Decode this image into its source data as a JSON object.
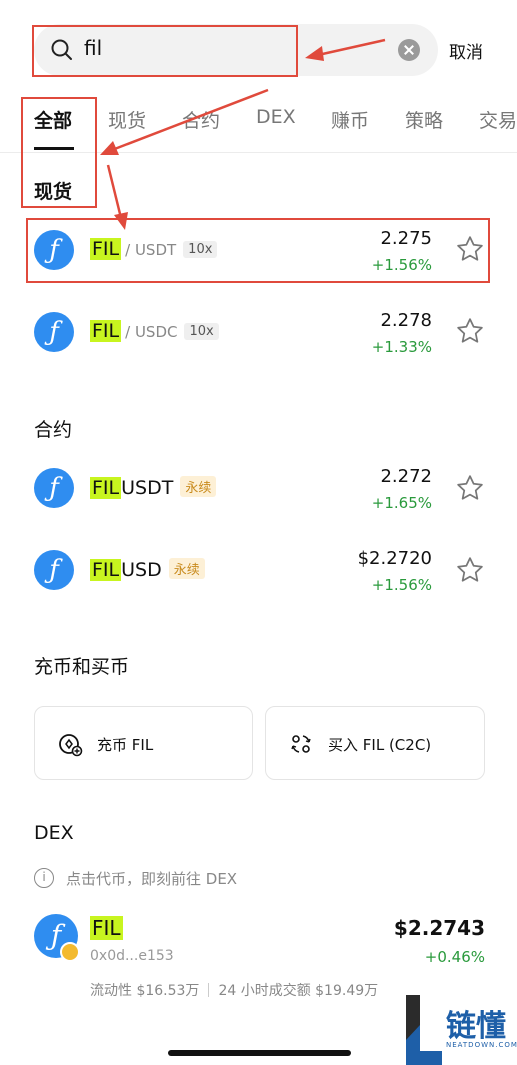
{
  "search": {
    "query": "fil",
    "cancel_label": "取消"
  },
  "tabs": [
    "全部",
    "现货",
    "合约",
    "DEX",
    "赚币",
    "策略",
    "交易"
  ],
  "spot": {
    "title": "现货",
    "rows": [
      {
        "base": "FIL",
        "quote": "/ USDT",
        "badge": "10x",
        "price": "2.275",
        "change": "+1.56%"
      },
      {
        "base": "FIL",
        "quote": "/ USDC",
        "badge": "10x",
        "price": "2.278",
        "change": "+1.33%"
      }
    ]
  },
  "futures": {
    "title": "合约",
    "rows": [
      {
        "base": "FIL",
        "rest": "USDT",
        "badge": "永续",
        "price": "2.272",
        "change": "+1.65%"
      },
      {
        "base": "FIL",
        "rest": "USD",
        "badge": "永续",
        "price": "$2.2720",
        "change": "+1.56%"
      }
    ]
  },
  "deposit": {
    "title": "充币和买币",
    "deposit_label": "充币 FIL",
    "buy_label": "买入 FIL (C2C)"
  },
  "dex": {
    "title": "DEX",
    "info": "点击代币，即刻前往 DEX",
    "name": "FIL",
    "address": "0x0d...e153",
    "price": "$2.2743",
    "change": "+0.46%",
    "liquidity": "流动性 $16.53万",
    "volume": "24 小时成交额 $19.49万"
  },
  "watermark": {
    "text": "链懂",
    "sub": "NEATDOWN.COM"
  },
  "colors": {
    "accent_green": "#2a9a3c",
    "highlight": "#c8f51f",
    "coin_blue": "#2f8df0",
    "annotation_red": "#e04a3c"
  }
}
